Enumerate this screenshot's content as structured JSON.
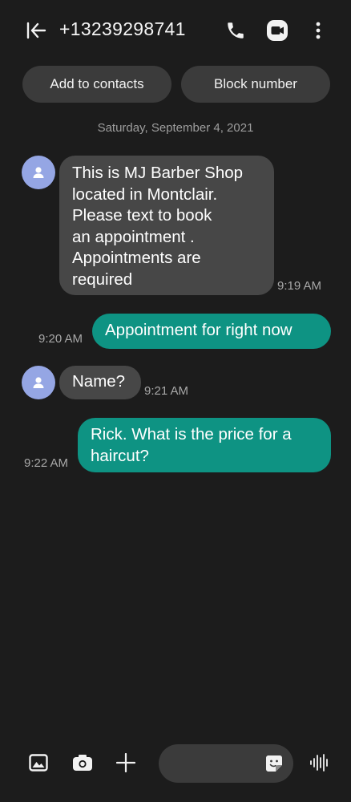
{
  "header": {
    "title": "+13239298741",
    "back_icon": "back-to-list-icon",
    "call_icon": "phone-icon",
    "video_icon": "video-call-icon",
    "more_icon": "more-vertical-icon"
  },
  "actions": {
    "add_contact": "Add to contacts",
    "block_number": "Block number"
  },
  "date_separator": "Saturday, September 4, 2021",
  "messages": [
    {
      "direction": "incoming",
      "lines": [
        "This is MJ Barber Shop",
        "located in Montclair.",
        "Please text to book",
        "an appointment .",
        "Appointments are",
        "required"
      ],
      "time": "9:19 AM"
    },
    {
      "direction": "outgoing",
      "lines": [
        "Appointment for right now"
      ],
      "time": "9:20 AM"
    },
    {
      "direction": "incoming",
      "lines": [
        "Name?"
      ],
      "time": "9:21 AM"
    },
    {
      "direction": "outgoing",
      "lines": [
        "Rick. What is the price for a",
        "haircut?"
      ],
      "time": "9:22 AM"
    }
  ],
  "composer": {
    "gallery_icon": "gallery-icon",
    "camera_icon": "camera-icon",
    "add_icon": "plus-icon",
    "input_value": "",
    "input_placeholder": "",
    "sticker_icon": "sticker-icon",
    "voice_icon": "voice-waveform-icon"
  },
  "colors": {
    "background": "#1c1c1c",
    "incoming_bubble": "#474747",
    "outgoing_bubble": "#0e9383",
    "avatar": "#95a6e4",
    "chip": "#3b3b3b"
  }
}
